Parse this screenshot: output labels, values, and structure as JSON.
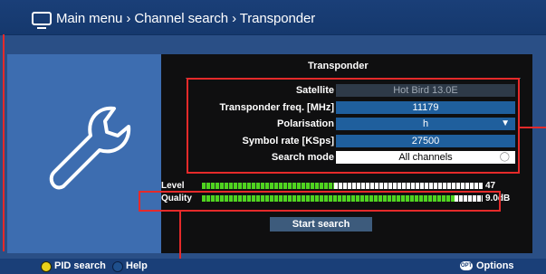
{
  "header": {
    "breadcrumb": "Main menu › Channel search › Transponder"
  },
  "panel": {
    "title": "Transponder"
  },
  "fields": [
    {
      "label": "Satellite",
      "value": "Hot Bird 13.0E"
    },
    {
      "label": "Transponder freq. [MHz]",
      "value": "11179"
    },
    {
      "label": "Polarisation",
      "value": "h"
    },
    {
      "label": "Symbol rate [KSps]",
      "value": "27500"
    },
    {
      "label": "Search mode",
      "value": "All channels"
    }
  ],
  "meters": [
    {
      "label": "Level",
      "value": "47",
      "fraction": 0.47
    },
    {
      "label": "Quality",
      "value": "9.0dB",
      "fraction": 0.9
    }
  ],
  "actions": {
    "start_search": "Start search"
  },
  "footer": {
    "pid_search": "PID search",
    "help": "Help",
    "options": "Options",
    "options_key": "OPT"
  },
  "colors": {
    "accent_blue": "#1f5f9d",
    "level_green": "#4fd41f",
    "highlight_red": "#e52a2a"
  },
  "icons": [
    "tv-icon",
    "wrench-icon",
    "chevron-down-icon",
    "search-mode-icon",
    "yellow-key-icon",
    "blue-key-icon",
    "options-key-icon"
  ]
}
